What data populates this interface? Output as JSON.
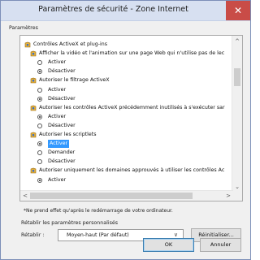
{
  "window": {
    "title": "Paramètres de sécurité - Zone Internet",
    "close_glyph": "✕"
  },
  "settings_label": "Paramètres",
  "tree": [
    {
      "kind": "category",
      "text": "Contrôles ActiveX et plug-ins"
    },
    {
      "kind": "setting",
      "text": "Afficher la vidéo et l'animation sur une page Web qui n'utilise pas de lec"
    },
    {
      "kind": "option",
      "text": "Activer",
      "checked": false
    },
    {
      "kind": "option",
      "text": "Désactiver",
      "checked": true
    },
    {
      "kind": "setting",
      "text": "Autoriser le filtrage ActiveX"
    },
    {
      "kind": "option",
      "text": "Activer",
      "checked": false
    },
    {
      "kind": "option",
      "text": "Désactiver",
      "checked": true
    },
    {
      "kind": "setting",
      "text": "Autoriser les contrôles ActiveX précédemment inutilisés à s'exécuter sar"
    },
    {
      "kind": "option",
      "text": "Activer",
      "checked": true
    },
    {
      "kind": "option",
      "text": "Désactiver",
      "checked": false
    },
    {
      "kind": "setting",
      "text": "Autoriser les scriptlets"
    },
    {
      "kind": "option",
      "text": "Activer",
      "checked": true,
      "selected": true
    },
    {
      "kind": "option",
      "text": "Demander",
      "checked": false
    },
    {
      "kind": "option",
      "text": "Désactiver",
      "checked": false
    },
    {
      "kind": "setting",
      "text": "Autoriser uniquement les domaines approuvés à utiliser les contrôles Ac"
    },
    {
      "kind": "option",
      "text": "Activer",
      "checked": true
    }
  ],
  "scroll": {
    "up": "^",
    "down": "⌄",
    "left": "<",
    "right": ">"
  },
  "note": "*Ne prend effet qu'après le redémarrage de votre ordinateur.",
  "reset": {
    "heading": "Rétablir les paramètres personnalisés",
    "label": "Rétablir :",
    "select_value": "Moyen-haut (Par défaut)",
    "chevron": "∨",
    "button": "Réinitialiser..."
  },
  "ok_label": "OK",
  "cancel_label": "Annuler",
  "colors": {
    "selection": "#3399ff",
    "close": "#c94c47",
    "titlebar": "#d7e0f1"
  }
}
